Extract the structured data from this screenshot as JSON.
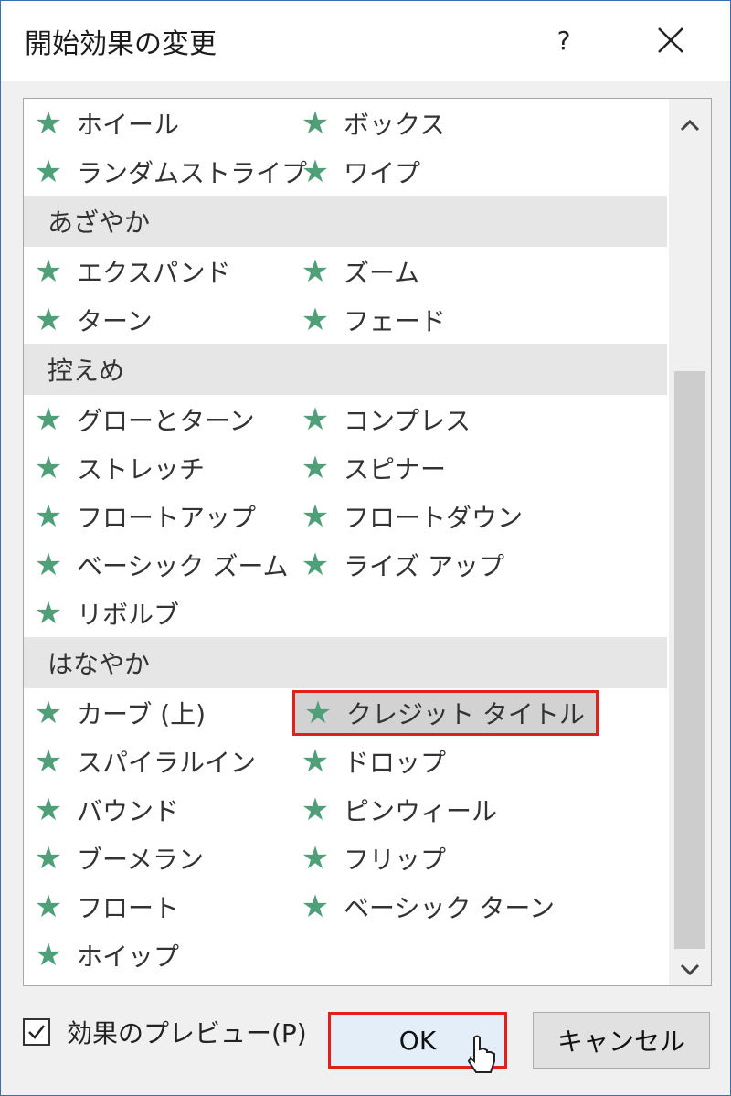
{
  "dialog": {
    "title": "開始効果の変更",
    "help_label": "?",
    "close_icon": "close-icon"
  },
  "list": {
    "rows": [
      {
        "type": "items",
        "items": [
          {
            "label": "ホイール"
          },
          {
            "label": "ボックス"
          }
        ]
      },
      {
        "type": "items",
        "items": [
          {
            "label": "ランダムストライプ"
          },
          {
            "label": "ワイプ"
          }
        ]
      },
      {
        "type": "category",
        "label": "あざやか"
      },
      {
        "type": "items",
        "items": [
          {
            "label": "エクスパンド"
          },
          {
            "label": "ズーム"
          }
        ]
      },
      {
        "type": "items",
        "items": [
          {
            "label": "ターン"
          },
          {
            "label": "フェード"
          }
        ]
      },
      {
        "type": "category",
        "label": "控えめ"
      },
      {
        "type": "items",
        "items": [
          {
            "label": "グローとターン"
          },
          {
            "label": "コンプレス"
          }
        ]
      },
      {
        "type": "items",
        "items": [
          {
            "label": "ストレッチ"
          },
          {
            "label": "スピナー"
          }
        ]
      },
      {
        "type": "items",
        "items": [
          {
            "label": "フロートアップ"
          },
          {
            "label": "フロートダウン"
          }
        ]
      },
      {
        "type": "items",
        "items": [
          {
            "label": "ベーシック ズーム"
          },
          {
            "label": "ライズ アップ"
          }
        ]
      },
      {
        "type": "items",
        "items": [
          {
            "label": "リボルブ"
          }
        ]
      },
      {
        "type": "category",
        "label": "はなやか"
      },
      {
        "type": "items",
        "items": [
          {
            "label": "カーブ (上)"
          },
          {
            "label": "クレジット タイトル",
            "selected": true
          }
        ]
      },
      {
        "type": "items",
        "items": [
          {
            "label": "スパイラルイン"
          },
          {
            "label": "ドロップ"
          }
        ]
      },
      {
        "type": "items",
        "items": [
          {
            "label": "バウンド"
          },
          {
            "label": "ピンウィール"
          }
        ]
      },
      {
        "type": "items",
        "items": [
          {
            "label": "ブーメラン"
          },
          {
            "label": "フリップ"
          }
        ]
      },
      {
        "type": "items",
        "items": [
          {
            "label": "フロート"
          },
          {
            "label": "ベーシック ターン"
          }
        ]
      },
      {
        "type": "items",
        "items": [
          {
            "label": "ホイップ"
          }
        ]
      }
    ]
  },
  "footer": {
    "preview_label": "効果のプレビュー(P)",
    "preview_checked": true,
    "ok_label": "OK",
    "cancel_label": "キャンセル"
  },
  "colors": {
    "star": "#4f9f79",
    "highlight_border": "#e0201a",
    "selected_bg": "#d2d2d2"
  }
}
